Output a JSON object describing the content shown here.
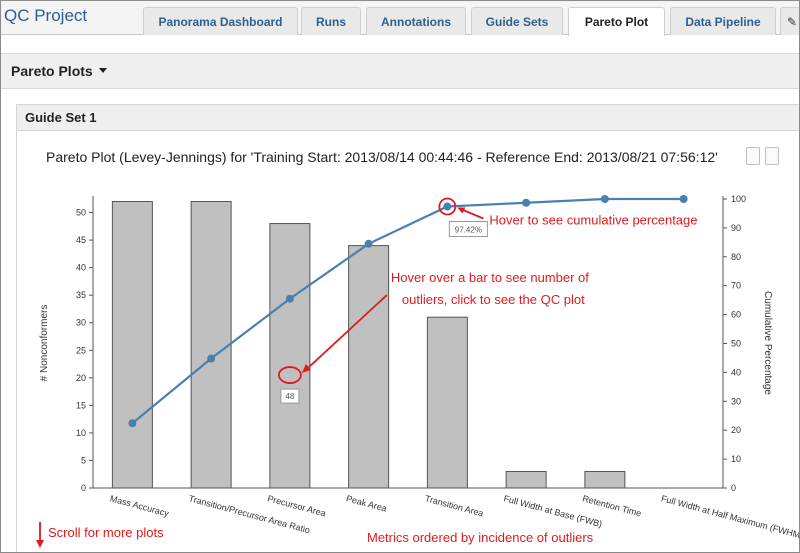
{
  "header": {
    "project_title": "QC Project",
    "tabs": [
      {
        "label": "Panorama Dashboard"
      },
      {
        "label": "Runs"
      },
      {
        "label": "Annotations"
      },
      {
        "label": "Guide Sets"
      },
      {
        "label": "Pareto Plot"
      },
      {
        "label": "Data Pipeline"
      }
    ],
    "active_tab": "Pareto Plot",
    "edit_icon": "pencil-icon"
  },
  "menu": {
    "label": "Pareto Plots",
    "icon": "caret-down-icon"
  },
  "panel": {
    "title": "Guide Set 1"
  },
  "plot": {
    "title": "Pareto Plot (Levey-Jennings) for 'Training Start: 2013/08/14 00:44:46 - Reference End: 2013/08/21 07:56:12'"
  },
  "chart_data": {
    "type": "bar",
    "categories": [
      "Mass Accuracy",
      "Transition/Precursor Area Ratio",
      "Precursor Area",
      "Peak Area",
      "Transition Area",
      "Full Width at Base (FWB)",
      "Retention Time",
      "Full Width at Half Maximum (FWHM)"
    ],
    "values": [
      52,
      52,
      48,
      44,
      31,
      3,
      3,
      0
    ],
    "bar_color": "#c0c0c0",
    "ylabel": "# Nonconformers",
    "ylim": [
      0,
      53
    ],
    "yticks": [
      0,
      5,
      10,
      15,
      20,
      25,
      30,
      35,
      40,
      45,
      50
    ],
    "y2label": "Cumulative Percentage",
    "y2lim": [
      0,
      100
    ],
    "y2ticks": [
      0,
      10,
      20,
      30,
      40,
      50,
      60,
      70,
      80,
      90,
      100
    ],
    "cumulative_series": {
      "color": "#4a7fb0",
      "values": [
        22.4,
        44.8,
        65.5,
        84.5,
        97.4,
        98.7,
        100,
        100
      ]
    },
    "grid": false,
    "tooltips": {
      "cumulative": "97.42%",
      "bar": "48"
    },
    "annotations": {
      "cumulative_hint": "Hover to see cumulative percentage",
      "bar_hint_line1": "Hover over a bar to see number of",
      "bar_hint_line2": "outliers, click to see the QC plot",
      "order_hint": "Metrics ordered by incidence of outliers",
      "scroll_hint": "Scroll for more plots"
    },
    "annotation_color": "#e01b1b"
  }
}
